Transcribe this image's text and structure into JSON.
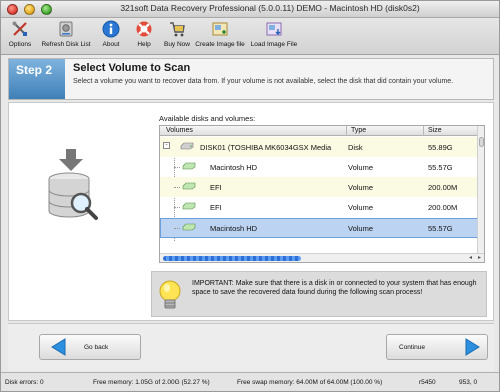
{
  "window": {
    "title": "321soft Data Recovery Professional (5.0.0.11) DEMO - Macintosh HD (disk0s2)"
  },
  "toolbar": {
    "items": [
      {
        "label": "Options",
        "icon": "options-icon"
      },
      {
        "label": "Refresh Disk List",
        "icon": "refresh-disk-icon"
      },
      {
        "label": "About",
        "icon": "info-icon"
      },
      {
        "label": "Help",
        "icon": "help-lifebuoy-icon"
      },
      {
        "label": "Buy Now",
        "icon": "cart-icon"
      },
      {
        "label": "Create Image file",
        "icon": "create-image-icon"
      },
      {
        "label": "Load Image File",
        "icon": "load-image-icon"
      }
    ]
  },
  "step": {
    "badge": "Step 2",
    "title": "Select Volume to Scan",
    "description": "Select a volume you want to recover data from. If your volume is not available, select the disk that did contain your volume."
  },
  "volumes": {
    "caption": "Available disks and volumes:",
    "columns": [
      "Volumes",
      "Type",
      "Size"
    ],
    "rows": [
      {
        "name": "DISK01 (TOSHIBA MK6034GSX Media",
        "type": "Disk",
        "size": "55.89G",
        "level": "disk"
      },
      {
        "name": "Macintosh HD",
        "type": "Volume",
        "size": "55.57G",
        "level": "volume"
      },
      {
        "name": "EFI",
        "type": "Volume",
        "size": "200.00M",
        "level": "volume"
      },
      {
        "name": "EFI",
        "type": "Volume",
        "size": "200.00M",
        "level": "volume"
      },
      {
        "name": "Macintosh HD",
        "type": "Volume",
        "size": "55.57G",
        "level": "volume",
        "selected": true
      }
    ],
    "expander": "-",
    "scroll_left": "◂",
    "scroll_right": "▸"
  },
  "notice": {
    "text": "IMPORTANT: Make sure that there is a disk in or connected to your system that has enough space to save the recovered data found during the following scan process!"
  },
  "nav": {
    "back_label": "Go back",
    "continue_label": "Continue"
  },
  "status": {
    "disk_errors": "Disk errors: 0",
    "free_memory": "Free memory: 1.05G of 2.00G (52.27 %)",
    "free_swap": "Free swap memory: 64.00M of 64.00M (100.00 %)",
    "code": "r5450",
    "counter": "953, 0"
  },
  "colors": {
    "accent_blue": "#3f80b8",
    "selection": "#bcd4f2",
    "row_alt": "#fbfbe4",
    "nav_arrow": "#2c8fe0"
  }
}
